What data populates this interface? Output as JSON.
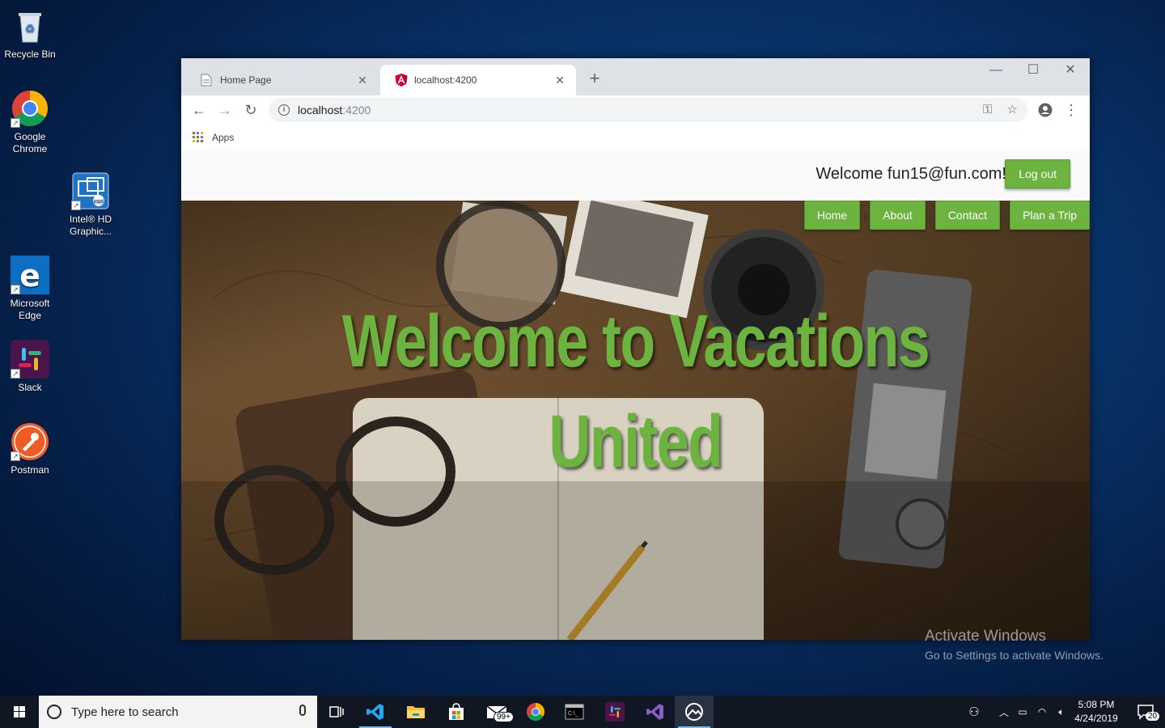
{
  "desktop": {
    "icons": [
      {
        "label": "Recycle Bin"
      },
      {
        "label": "Google Chrome"
      },
      {
        "label": "Intel® HD Graphic..."
      },
      {
        "label": "Microsoft Edge"
      },
      {
        "label": "Slack"
      },
      {
        "label": "Postman"
      }
    ],
    "watermark": {
      "title": "Activate Windows",
      "subtitle": "Go to Settings to activate Windows."
    }
  },
  "browser": {
    "tabs": [
      {
        "title": "Home Page",
        "active": false
      },
      {
        "title": "localhost:4200",
        "active": true
      }
    ],
    "address": {
      "host": "localhost",
      "port": ":4200"
    },
    "bookmarks": {
      "apps_label": "Apps"
    }
  },
  "page": {
    "welcome_text": "Welcome fun15@fun.com!",
    "logout_label": "Log out",
    "nav": [
      {
        "label": "Home"
      },
      {
        "label": "About"
      },
      {
        "label": "Contact"
      },
      {
        "label": "Plan a Trip"
      }
    ],
    "nav_separator": "|",
    "hero_line1": "Welcome to Vacations",
    "hero_line2": "United",
    "accent_color": "#6db33f"
  },
  "taskbar": {
    "search_placeholder": "Type here to search",
    "mail_badge": "99+",
    "time": "5:08 PM",
    "date": "4/24/2019",
    "notification_count": "20"
  }
}
